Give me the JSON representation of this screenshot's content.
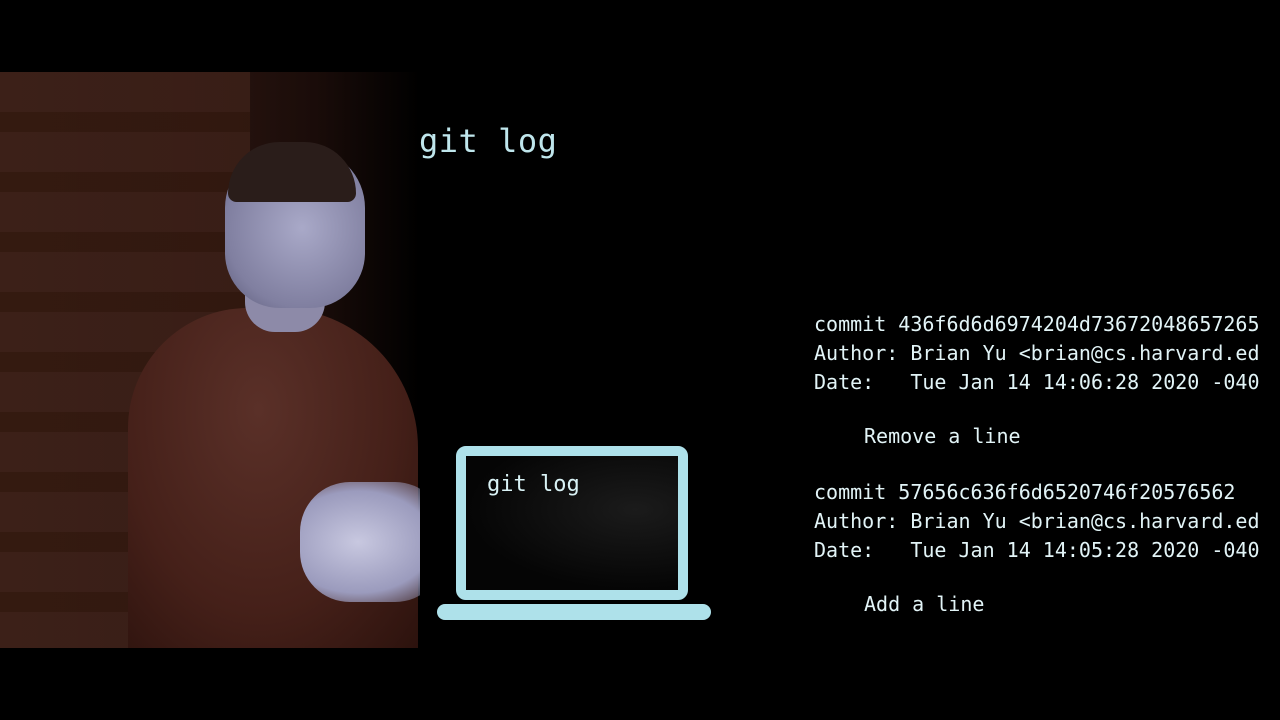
{
  "slide": {
    "title": "git log",
    "laptop_command": "git log",
    "log": [
      {
        "commit": "commit 436f6d6d6974204d73672048657265",
        "author": "Author: Brian Yu <brian@cs.harvard.ed",
        "date": "Date:   Tue Jan 14 14:06:28 2020 -040",
        "message": "Remove a line"
      },
      {
        "commit": "commit 57656c636f6d6520746f20576562",
        "author": "Author: Brian Yu <brian@cs.harvard.ed",
        "date": "Date:   Tue Jan 14 14:05:28 2020 -040",
        "message": "Add a line"
      }
    ]
  },
  "colors": {
    "text": "#e2f4f7",
    "title": "#bfe6ec",
    "laptop_outline": "#aee1ea",
    "background": "#000000"
  }
}
